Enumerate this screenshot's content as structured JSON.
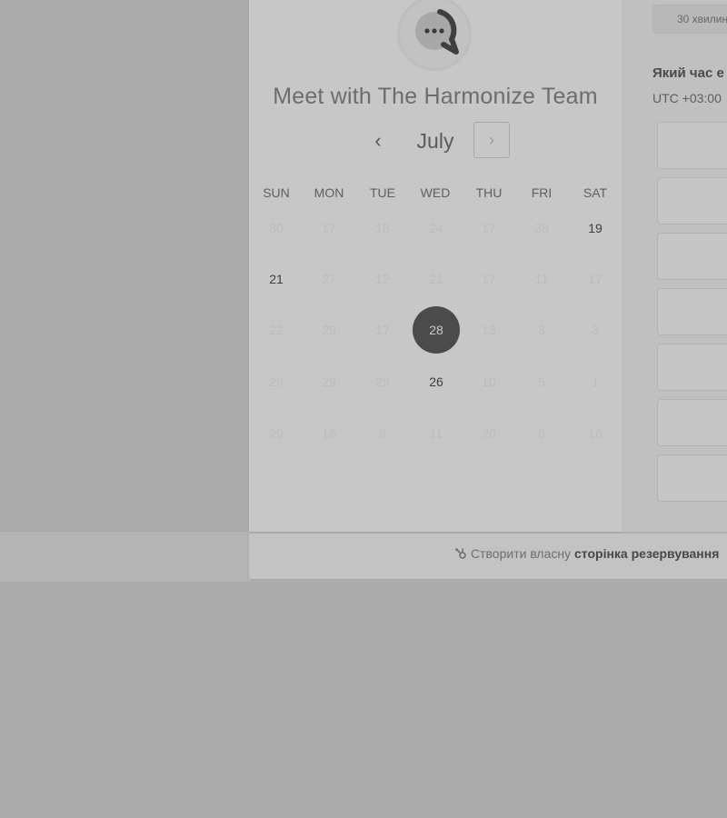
{
  "calendar": {
    "title": "Meet with The Harmonize Team",
    "month": "July",
    "prev_icon": "‹",
    "next_icon": "›",
    "weekdays": [
      "SUN",
      "MON",
      "TUE",
      "WED",
      "THU",
      "FRI",
      "SAT"
    ],
    "weeks": [
      [
        "30",
        "17",
        "18",
        "24",
        "17",
        "28",
        "19"
      ],
      [
        "21",
        "27",
        "12",
        "21",
        "17",
        "11",
        "17"
      ],
      [
        "22",
        "29",
        "17",
        "28",
        "13",
        "3",
        "3"
      ],
      [
        "29",
        "29",
        "29",
        "26",
        "10",
        "5",
        "1"
      ],
      [
        "29",
        "16",
        "8",
        "11",
        "20",
        "6",
        "16"
      ]
    ],
    "available_days": [
      "19",
      "21",
      "26"
    ],
    "selected_day": "28"
  },
  "right_panel": {
    "duration_tab": "30 хвилин",
    "question": "Який час е",
    "timezone": "UTC +03:00",
    "slot_count": 7
  },
  "footer": {
    "link_prefix": "Створити власну",
    "link_bold": "сторінка резервування"
  },
  "icons": {
    "avatar": "chat-bubble-icon",
    "footer": "sprocket-icon"
  },
  "colors": {
    "selected_day_bg": "#4b4b4b",
    "overlay_bg": "#ababab"
  }
}
